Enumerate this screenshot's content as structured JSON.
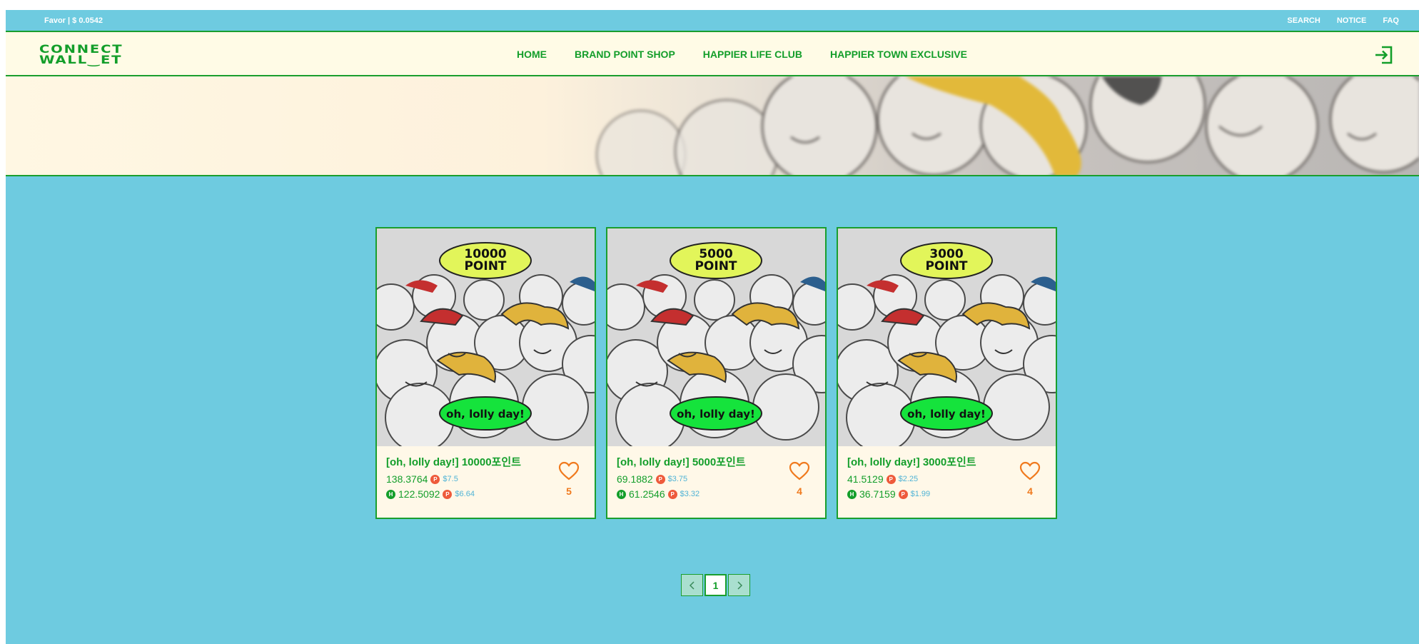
{
  "topbar": {
    "favor": "Favor | $ 0.0542",
    "links": [
      "SEARCH",
      "NOTICE",
      "FAQ"
    ]
  },
  "logo": {
    "line1": "CONNECT",
    "line2": "WALL‿ET"
  },
  "nav": [
    "HOME",
    "BRAND POINT SHOP",
    "HAPPIER LIFE CLUB",
    "HAPPIER TOWN EXCLUSIVE"
  ],
  "login_icon": "login-icon",
  "products": [
    {
      "badge_top": [
        "10000",
        "POINT"
      ],
      "badge_bottom": "oh, lolly day!",
      "title": "[oh, lolly day!] 10000포인트",
      "price_favor": "138.3764",
      "usd_favor": "$7.5",
      "price_h": "122.5092",
      "usd_h": "$6.64",
      "likes": "5"
    },
    {
      "badge_top": [
        "5000",
        "POINT"
      ],
      "badge_bottom": "oh, lolly day!",
      "title": "[oh, lolly day!] 5000포인트",
      "price_favor": "69.1882",
      "usd_favor": "$3.75",
      "price_h": "61.2546",
      "usd_h": "$3.32",
      "likes": "4"
    },
    {
      "badge_top": [
        "3000",
        "POINT"
      ],
      "badge_bottom": "oh, lolly day!",
      "title": "[oh, lolly day!] 3000포인트",
      "price_favor": "41.5129",
      "usd_favor": "$2.25",
      "price_h": "36.7159",
      "usd_h": "$1.99",
      "likes": "4"
    }
  ],
  "pagination": {
    "current": "1"
  },
  "coin_icons": {
    "favor": "P",
    "happier": "H"
  },
  "colors": {
    "background": "#6ecbe0",
    "brand_green": "#139e2a",
    "cream": "#fffbe6",
    "heart_orange": "#f07a1e"
  }
}
